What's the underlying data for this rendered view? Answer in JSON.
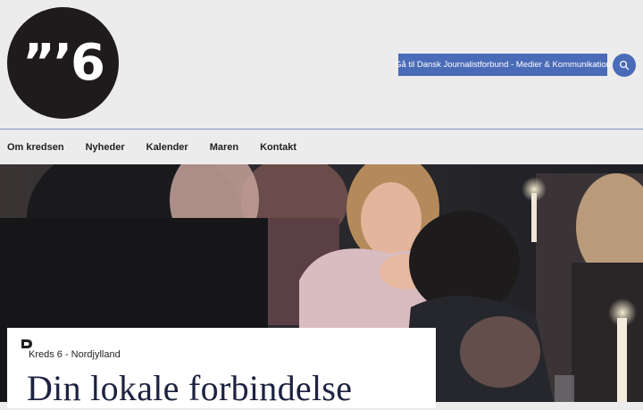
{
  "logo": {
    "mark": "”’6",
    "icon": "kreds6-logo-icon"
  },
  "header": {
    "cta_label": "Gå til Dansk Journalistforbund - Medier & Kommunikation",
    "search_icon": "search-icon"
  },
  "nav": {
    "items": [
      {
        "label": "Om kredsen"
      },
      {
        "label": "Nyheder"
      },
      {
        "label": "Kalender"
      },
      {
        "label": "Maren"
      },
      {
        "label": "Kontakt"
      }
    ]
  },
  "hero": {
    "image_icon": "hero-photo-icon",
    "card": {
      "label": "Kreds 6 - Nordjylland",
      "title": "Din lokale forbindelse",
      "icon": "dj-mark-icon"
    }
  },
  "colors": {
    "accent": "#4a6bb8",
    "background": "#ececec",
    "title": "#1c2240",
    "logo_bg": "#1f1b1c"
  }
}
